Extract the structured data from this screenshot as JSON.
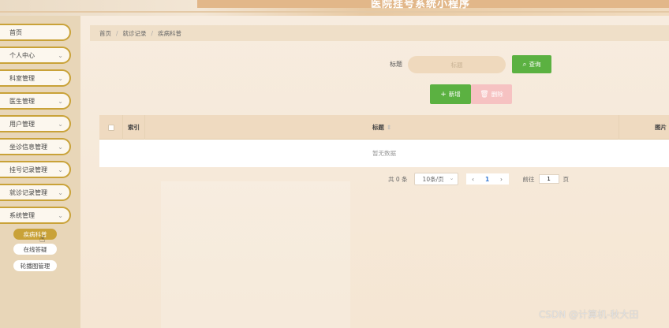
{
  "header": {
    "title": "医院挂号系统小程序"
  },
  "sidebar": {
    "items": [
      {
        "label": "首页",
        "chevron": false
      },
      {
        "label": "个人中心",
        "chevron": true
      },
      {
        "label": "科室管理",
        "chevron": true
      },
      {
        "label": "医生管理",
        "chevron": true
      },
      {
        "label": "用户管理",
        "chevron": true
      },
      {
        "label": "坐诊信息管理",
        "chevron": true
      },
      {
        "label": "挂号记录管理",
        "chevron": true
      },
      {
        "label": "就诊记录管理",
        "chevron": true
      },
      {
        "label": "系统管理",
        "chevron": true
      }
    ],
    "subitems": [
      {
        "label": "疾病科普",
        "active": true
      },
      {
        "label": "在线答疑",
        "active": false
      },
      {
        "label": "轮播图管理",
        "active": false
      }
    ],
    "chevron_icon": "chevron-down-icon"
  },
  "breadcrumb": [
    "首页",
    "就诊记录",
    "疾病科普"
  ],
  "search": {
    "label": "标题",
    "placeholder": "标题",
    "button_label": "查询",
    "button_icon": "search-icon"
  },
  "actions": {
    "add_label": "新增",
    "add_icon": "plus-icon",
    "delete_label": "删除",
    "delete_icon": "trash-icon"
  },
  "table": {
    "columns": [
      "索引",
      "标题",
      "图片"
    ],
    "empty_text": "暂无数据"
  },
  "pagination": {
    "total_text": "共 0 条",
    "page_size": "10条/页",
    "current_page": "1",
    "goto_prefix": "前往",
    "goto_value": "1",
    "goto_suffix": "页"
  },
  "watermark": "CSDN @计算机-秋大田",
  "colors": {
    "accent_gold": "#c9a238",
    "success_green": "#5bb141",
    "danger_pink": "#f6c2c2",
    "sidebar_bg": "#e8d6b8"
  }
}
